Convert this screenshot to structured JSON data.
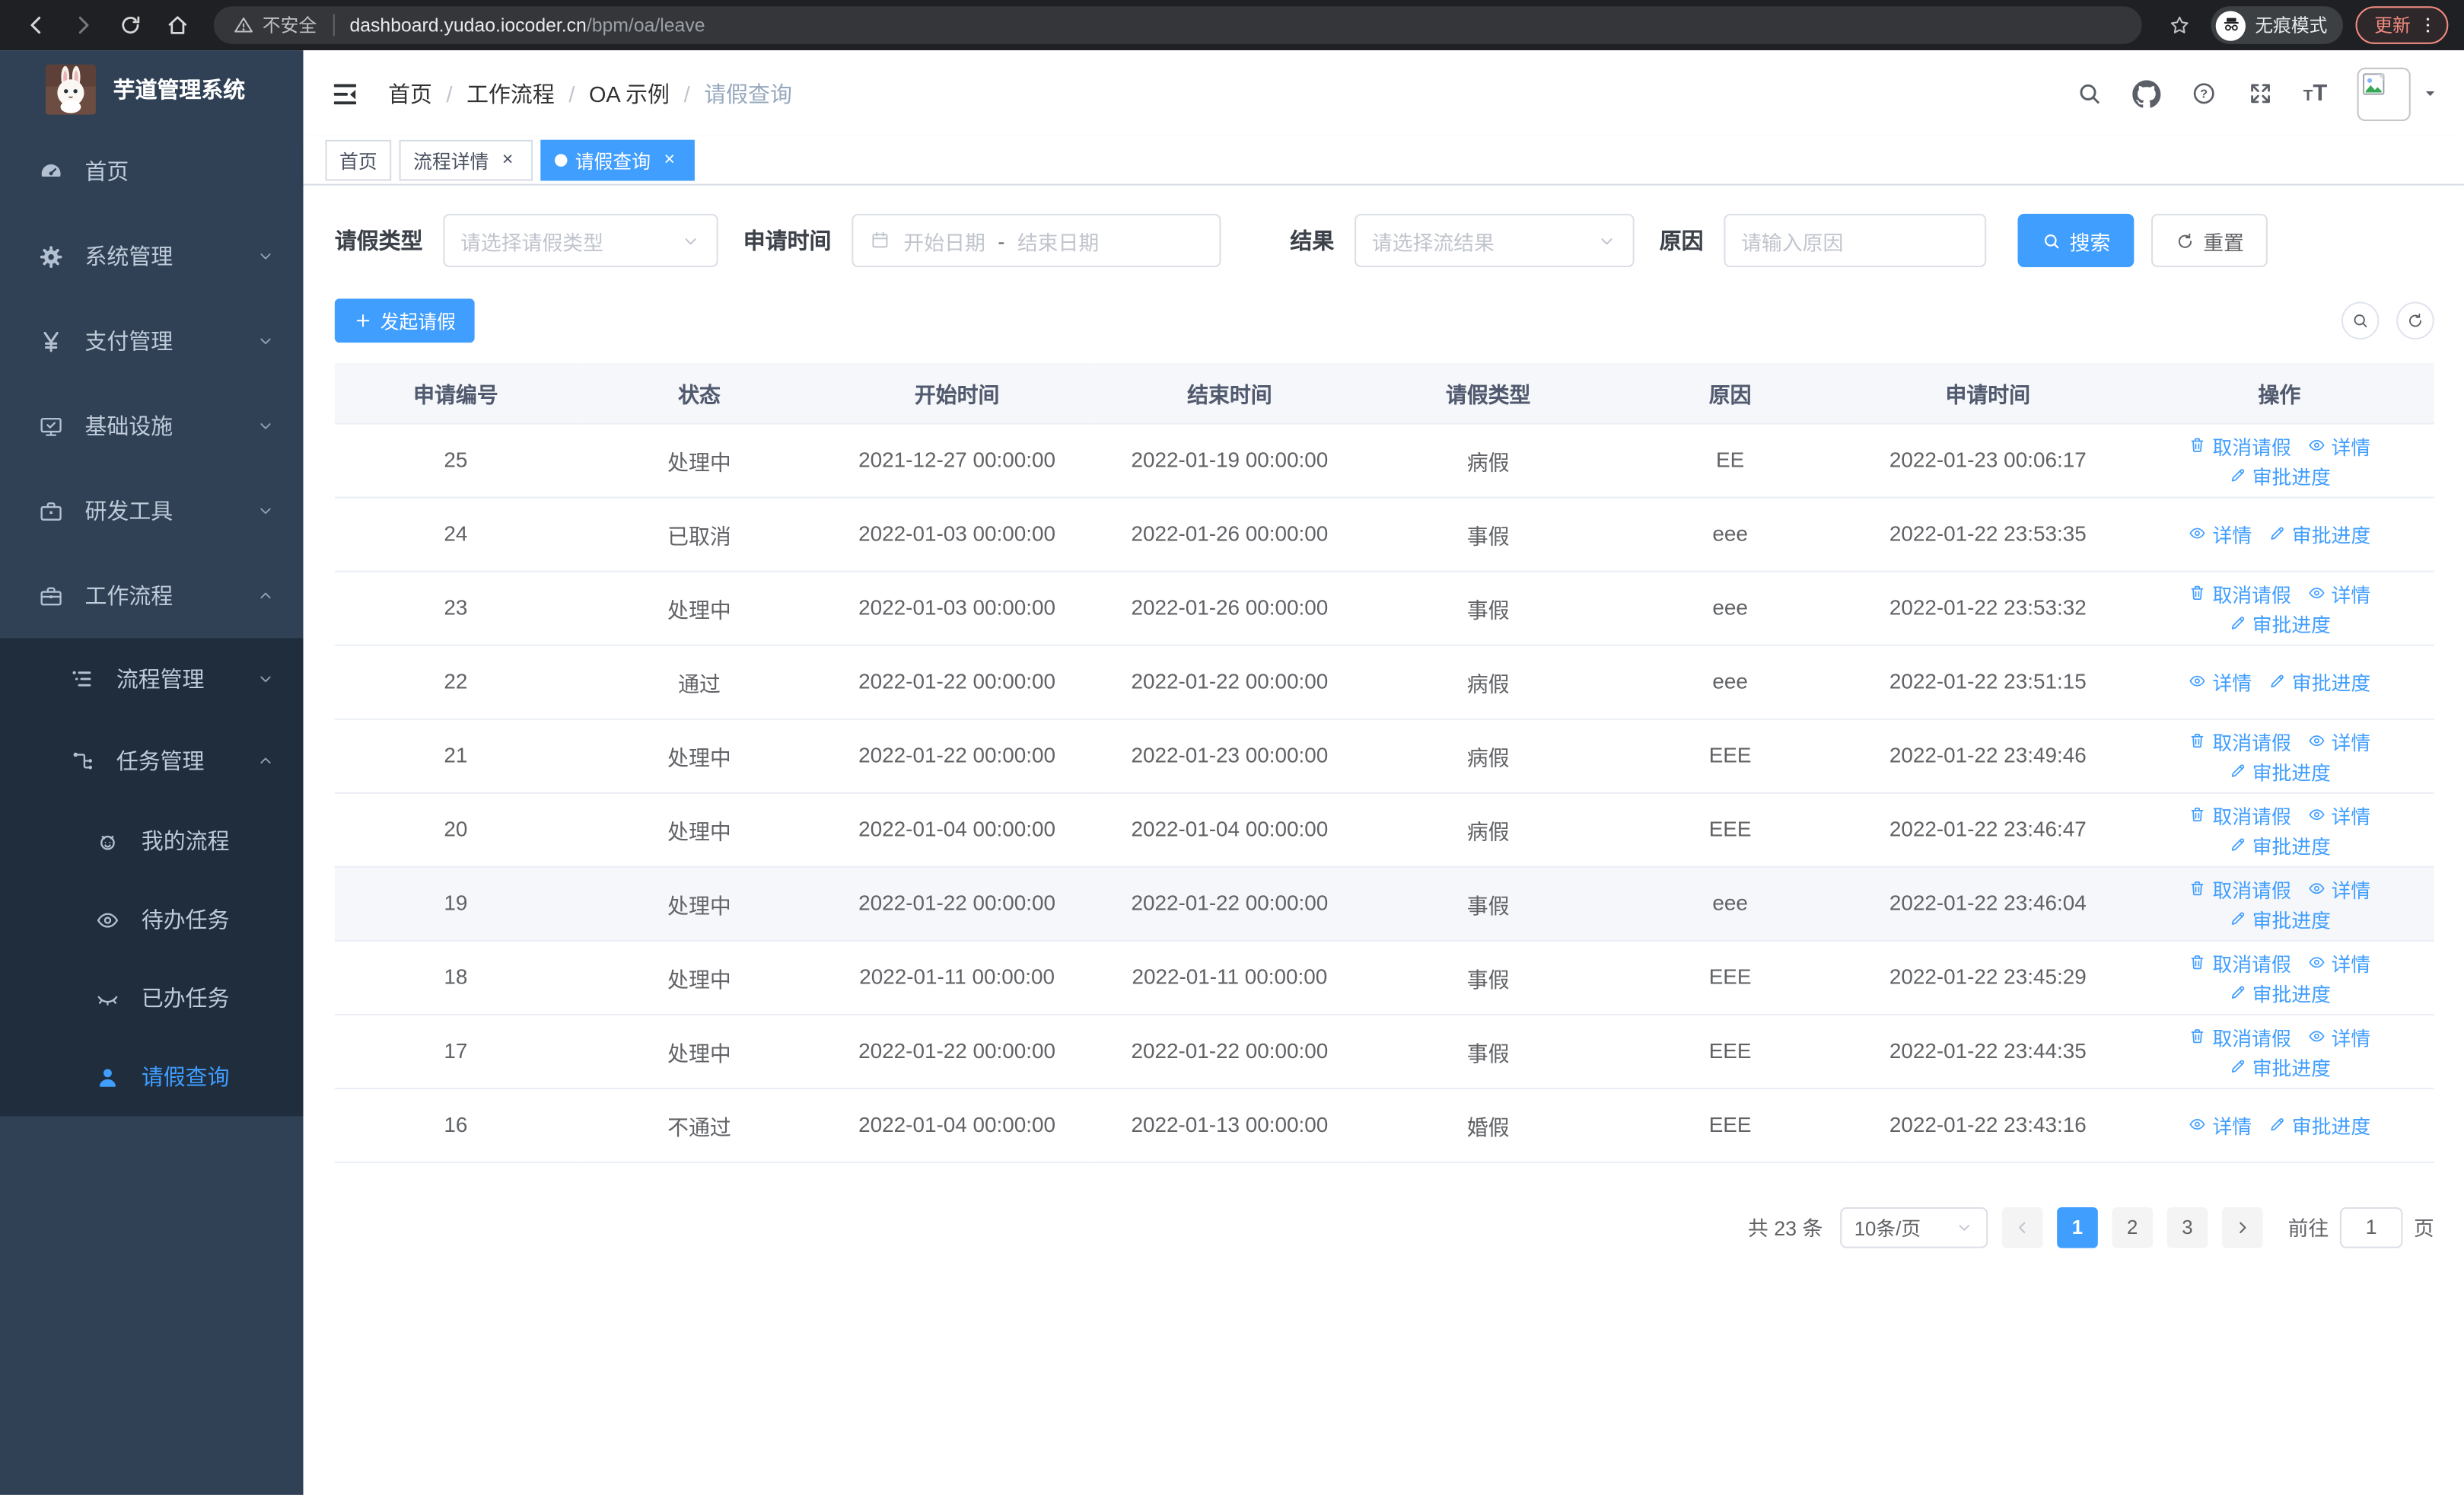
{
  "browser": {
    "security_warning": "不安全",
    "url_host": "dashboard.yudao.iocoder.cn",
    "url_path": "/bpm/oa/leave",
    "incognito_label": "无痕模式",
    "update_label": "更新"
  },
  "sidebar": {
    "app_title": "芋道管理系统",
    "logo_icon": "rabbit-avatar",
    "items": [
      {
        "label": "首页",
        "icon": "dashboard-icon"
      },
      {
        "label": "系统管理",
        "icon": "gear-icon",
        "chevron": "down"
      },
      {
        "label": "支付管理",
        "icon": "yen-icon",
        "chevron": "down"
      },
      {
        "label": "基础设施",
        "icon": "monitor-icon",
        "chevron": "down"
      },
      {
        "label": "研发工具",
        "icon": "toolbox-icon",
        "chevron": "down"
      },
      {
        "label": "工作流程",
        "icon": "briefcase-icon",
        "chevron": "up",
        "expanded": true,
        "children": [
          {
            "label": "流程管理",
            "icon": "list-icon",
            "chevron": "down"
          },
          {
            "label": "任务管理",
            "icon": "tree-icon",
            "chevron": "up",
            "expanded": true,
            "children": [
              {
                "label": "我的流程",
                "icon": "face-icon"
              },
              {
                "label": "待办任务",
                "icon": "eye-open-icon"
              },
              {
                "label": "已办任务",
                "icon": "eye-closed-icon"
              },
              {
                "label": "请假查询",
                "icon": "user-icon",
                "active": true
              }
            ]
          }
        ]
      }
    ]
  },
  "breadcrumb": {
    "items": [
      "首页",
      "工作流程",
      "OA 示例",
      "请假查询"
    ]
  },
  "tabs": [
    {
      "label": "首页",
      "closable": false,
      "active": false
    },
    {
      "label": "流程详情",
      "closable": true,
      "active": false
    },
    {
      "label": "请假查询",
      "closable": true,
      "active": true
    }
  ],
  "filters": {
    "leave_type_label": "请假类型",
    "leave_type_placeholder": "请选择请假类型",
    "apply_time_label": "申请时间",
    "start_placeholder": "开始日期",
    "range_separator": "-",
    "end_placeholder": "结束日期",
    "result_label": "结果",
    "result_placeholder": "请选择流结果",
    "reason_label": "原因",
    "reason_placeholder": "请输入原因",
    "search_label": "搜索",
    "reset_label": "重置"
  },
  "toolbar": {
    "create_label": "发起请假"
  },
  "table": {
    "columns": [
      "申请编号",
      "状态",
      "开始时间",
      "结束时间",
      "请假类型",
      "原因",
      "申请时间",
      "操作"
    ],
    "action_labels": {
      "cancel": "取消请假",
      "detail": "详情",
      "progress": "审批进度"
    },
    "rows": [
      {
        "id": "25",
        "status": "处理中",
        "start_time": "2021-12-27 00:00:00",
        "end_time": "2022-01-19 00:00:00",
        "leave_type": "病假",
        "reason": "EE",
        "apply_time": "2022-01-23 00:06:17",
        "actions": [
          "cancel",
          "detail",
          "progress"
        ]
      },
      {
        "id": "24",
        "status": "已取消",
        "start_time": "2022-01-03 00:00:00",
        "end_time": "2022-01-26 00:00:00",
        "leave_type": "事假",
        "reason": "eee",
        "apply_time": "2022-01-22 23:53:35",
        "actions": [
          "detail",
          "progress"
        ]
      },
      {
        "id": "23",
        "status": "处理中",
        "start_time": "2022-01-03 00:00:00",
        "end_time": "2022-01-26 00:00:00",
        "leave_type": "事假",
        "reason": "eee",
        "apply_time": "2022-01-22 23:53:32",
        "actions": [
          "cancel",
          "detail",
          "progress"
        ]
      },
      {
        "id": "22",
        "status": "通过",
        "start_time": "2022-01-22 00:00:00",
        "end_time": "2022-01-22 00:00:00",
        "leave_type": "病假",
        "reason": "eee",
        "apply_time": "2022-01-22 23:51:15",
        "actions": [
          "detail",
          "progress"
        ]
      },
      {
        "id": "21",
        "status": "处理中",
        "start_time": "2022-01-22 00:00:00",
        "end_time": "2022-01-23 00:00:00",
        "leave_type": "病假",
        "reason": "EEE",
        "apply_time": "2022-01-22 23:49:46",
        "actions": [
          "cancel",
          "detail",
          "progress"
        ]
      },
      {
        "id": "20",
        "status": "处理中",
        "start_time": "2022-01-04 00:00:00",
        "end_time": "2022-01-04 00:00:00",
        "leave_type": "病假",
        "reason": "EEE",
        "apply_time": "2022-01-22 23:46:47",
        "actions": [
          "cancel",
          "detail",
          "progress"
        ]
      },
      {
        "id": "19",
        "status": "处理中",
        "start_time": "2022-01-22 00:00:00",
        "end_time": "2022-01-22 00:00:00",
        "leave_type": "事假",
        "reason": "eee",
        "apply_time": "2022-01-22 23:46:04",
        "actions": [
          "cancel",
          "detail",
          "progress"
        ],
        "highlighted": true
      },
      {
        "id": "18",
        "status": "处理中",
        "start_time": "2022-01-11 00:00:00",
        "end_time": "2022-01-11 00:00:00",
        "leave_type": "事假",
        "reason": "EEE",
        "apply_time": "2022-01-22 23:45:29",
        "actions": [
          "cancel",
          "detail",
          "progress"
        ]
      },
      {
        "id": "17",
        "status": "处理中",
        "start_time": "2022-01-22 00:00:00",
        "end_time": "2022-01-22 00:00:00",
        "leave_type": "事假",
        "reason": "EEE",
        "apply_time": "2022-01-22 23:44:35",
        "actions": [
          "cancel",
          "detail",
          "progress"
        ]
      },
      {
        "id": "16",
        "status": "不通过",
        "start_time": "2022-01-04 00:00:00",
        "end_time": "2022-01-13 00:00:00",
        "leave_type": "婚假",
        "reason": "EEE",
        "apply_time": "2022-01-22 23:43:16",
        "actions": [
          "detail",
          "progress"
        ]
      }
    ]
  },
  "pagination": {
    "total_label": "共 23 条",
    "page_size_label": "10条/页",
    "pages": [
      "1",
      "2",
      "3"
    ],
    "current_page": "1",
    "goto_label": "前往",
    "goto_value": "1",
    "page_unit_label": "页"
  },
  "colors": {
    "accent": "#409eff",
    "sidebar_bg": "#304156",
    "submenu_bg": "#1f2d3d",
    "update_warning": "#f28b82"
  }
}
